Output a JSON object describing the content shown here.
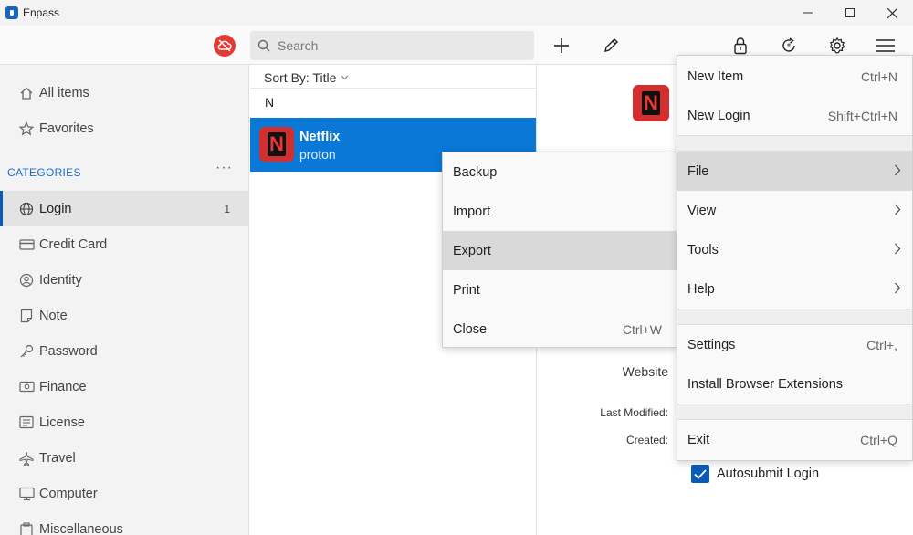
{
  "app": {
    "title": "Enpass"
  },
  "colors": {
    "accent": "#0a78d7",
    "sync_off": "#e53935",
    "netflix": "#d32f2f"
  },
  "toolbar": {
    "search_placeholder": "Search"
  },
  "sidebar": {
    "all_items": "All items",
    "favorites": "Favorites",
    "categories_header": "CATEGORIES",
    "categories": [
      {
        "label": "Login",
        "count": "1",
        "icon": "globe-icon"
      },
      {
        "label": "Credit Card",
        "count": "",
        "icon": "credit-card-icon"
      },
      {
        "label": "Identity",
        "count": "",
        "icon": "identity-icon"
      },
      {
        "label": "Note",
        "count": "",
        "icon": "note-icon"
      },
      {
        "label": "Password",
        "count": "",
        "icon": "key-icon"
      },
      {
        "label": "Finance",
        "count": "",
        "icon": "finance-icon"
      },
      {
        "label": "License",
        "count": "",
        "icon": "license-icon"
      },
      {
        "label": "Travel",
        "count": "",
        "icon": "plane-icon"
      },
      {
        "label": "Computer",
        "count": "",
        "icon": "computer-icon"
      },
      {
        "label": "Miscellaneous",
        "count": "",
        "icon": "misc-icon"
      }
    ]
  },
  "list": {
    "sort_label": "Sort By: Title",
    "group_letter": "N",
    "items": [
      {
        "title": "Netflix",
        "subtitle": "proton"
      }
    ]
  },
  "detail": {
    "website_label": "Website",
    "last_modified_label": "Last Modified:",
    "created_label": "Created:",
    "autosubmit_label": "Autosubmit Login",
    "autosubmit_checked": true
  },
  "main_menu": {
    "new_item": {
      "label": "New Item",
      "shortcut": "Ctrl+N"
    },
    "new_login": {
      "label": "New Login",
      "shortcut": "Shift+Ctrl+N"
    },
    "file": "File",
    "view": "View",
    "tools": "Tools",
    "help": "Help",
    "settings": {
      "label": "Settings",
      "shortcut": "Ctrl+,"
    },
    "install_ext": "Install Browser Extensions",
    "exit": {
      "label": "Exit",
      "shortcut": "Ctrl+Q"
    }
  },
  "file_menu": {
    "backup": "Backup",
    "import": "Import",
    "export": "Export",
    "print": "Print",
    "close": {
      "label": "Close",
      "shortcut": "Ctrl+W"
    }
  }
}
